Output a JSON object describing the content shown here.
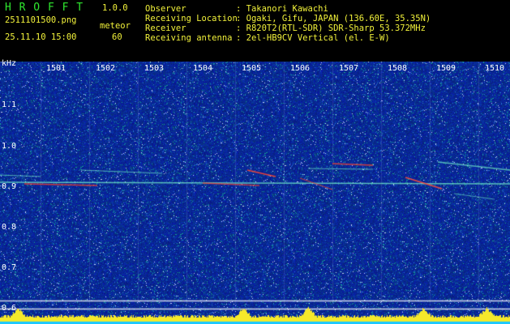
{
  "app": {
    "name": "H R O F F T",
    "version": "1.0.0",
    "filename": "2511101500.png",
    "datetime": "25.11.10 15:00",
    "mode_label": "meteor",
    "mode_value": "60"
  },
  "info": {
    "rows": [
      {
        "key": "Observer",
        "value": ": Takanori Kawachi"
      },
      {
        "key": "Receiving Location",
        "value": ": Ogaki, Gifu, JAPAN (136.60E, 35.35N)"
      },
      {
        "key": "Receiver",
        "value": ": R820T2(RTL-SDR) SDR-Sharp 53.372MHz"
      },
      {
        "key": "Receiving antenna",
        "value": ": 2el-HB9CV Vertical (el. E-W)"
      }
    ]
  },
  "axis": {
    "unit": "kHz",
    "y_ticks": [
      "1.1",
      "1.0",
      "0.9",
      "0.8",
      "0.7",
      "0.6"
    ],
    "x_ticks": [
      "1501",
      "1502",
      "1503",
      "1504",
      "1505",
      "1506",
      "1507",
      "1508",
      "1509",
      "1510"
    ]
  },
  "colors": {
    "background": "#0a1a8c",
    "header_green": "#2fe82f",
    "header_yellow": "#f2f23a",
    "trace": "#ff3b1f",
    "meter": "#f5e92a"
  }
}
